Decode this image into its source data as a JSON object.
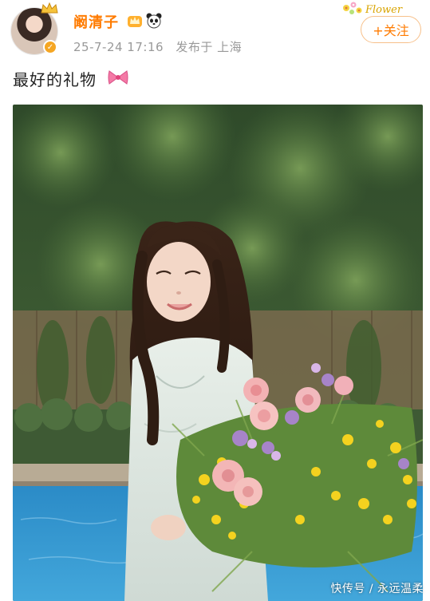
{
  "post": {
    "author_name": "阚清子",
    "timestamp": "25-7-24 17:16",
    "posted_from": "发布于 上海",
    "follow_label": "+关注",
    "text": "最好的礼物"
  },
  "decorations": {
    "flower_banner_text": "Flower"
  },
  "watermark": {
    "text": "快传号 / 永远温柔"
  },
  "icons": {
    "verified": "verified-badge-icon",
    "crown": "crown-icon",
    "panda": "panda-icon",
    "bow": "bow-icon"
  },
  "colors": {
    "username": "#ff7b00",
    "follow_border": "#f7c08a",
    "meta": "#999999"
  }
}
